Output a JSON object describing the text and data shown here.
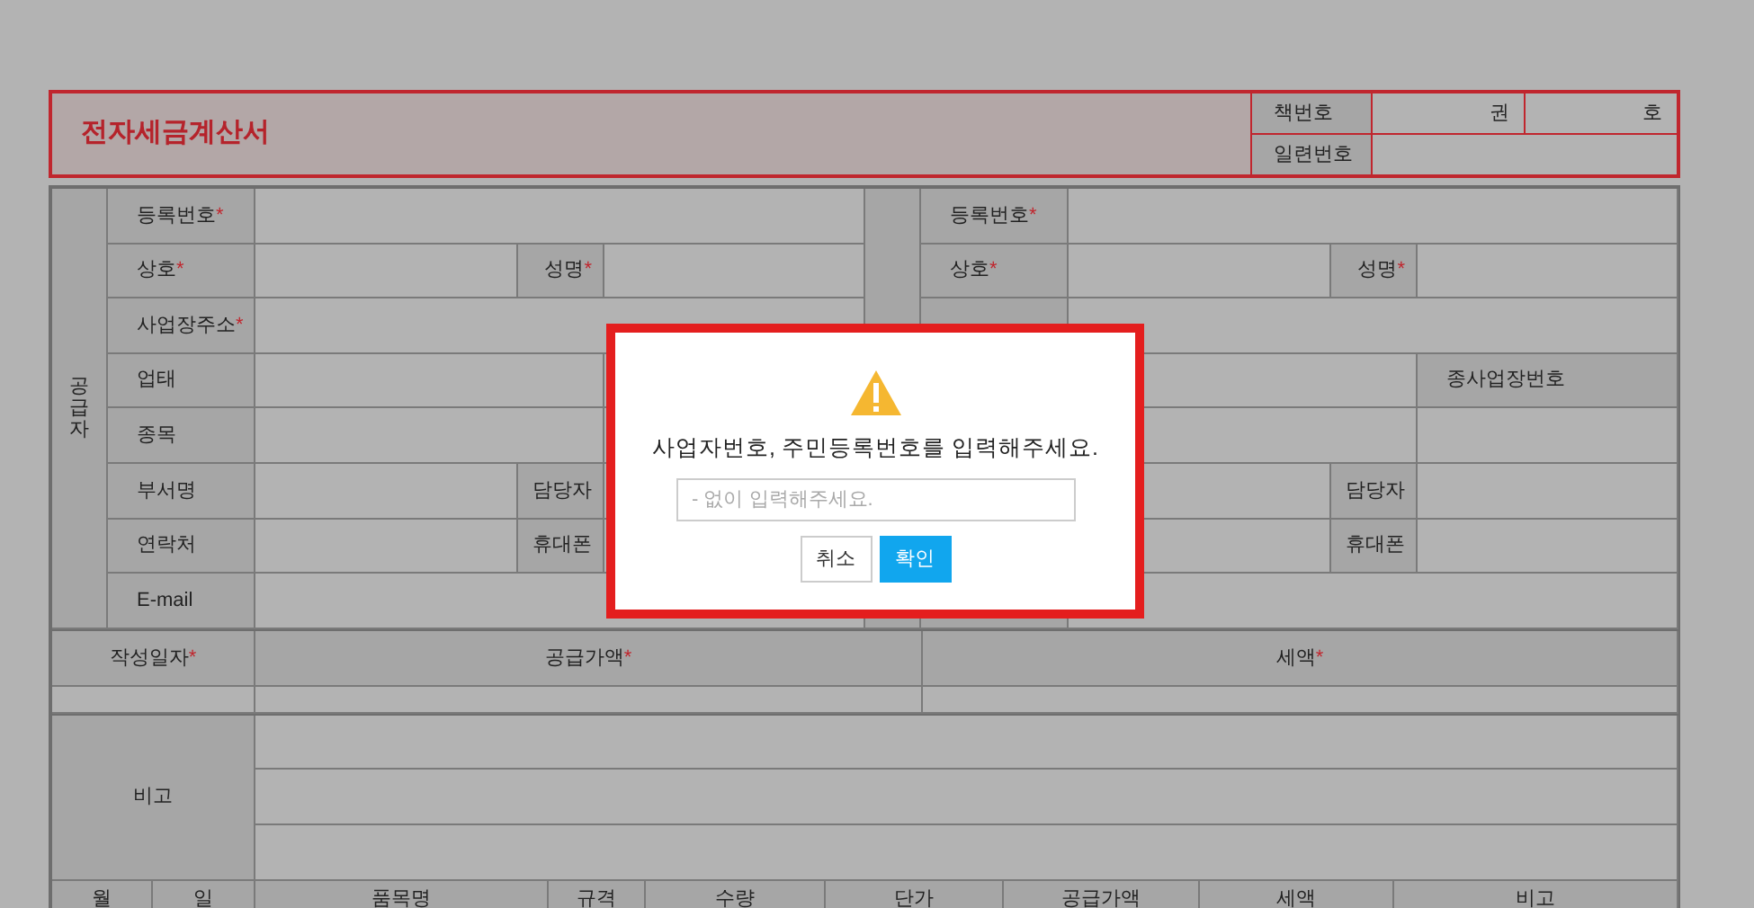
{
  "header": {
    "title": "전자세금계산서",
    "book_number_label": "책번호",
    "volume_unit": "권",
    "issue_unit": "호",
    "serial_number_label": "일련번호"
  },
  "supplier": {
    "section_label": "공급자",
    "rows": [
      {
        "kind": "single",
        "label": {
          "text": "등록번호",
          "mark": "*"
        }
      },
      {
        "kind": "pair",
        "label": {
          "text": "상호",
          "mark": "*"
        },
        "label2": {
          "text": "성명",
          "mark": "*"
        }
      },
      {
        "kind": "single",
        "label": {
          "text": "사업장주소",
          "mark": "*"
        }
      },
      {
        "kind": "split",
        "label": {
          "text": "업태"
        }
      },
      {
        "kind": "split",
        "label": {
          "text": "종목"
        }
      },
      {
        "kind": "pair",
        "label": {
          "text": "부서명"
        },
        "label2": {
          "text": "담당자"
        }
      },
      {
        "kind": "pair",
        "label": {
          "text": "연락처"
        },
        "label2": {
          "text": "휴대폰"
        }
      },
      {
        "kind": "single",
        "label": {
          "text": "E-mail"
        }
      }
    ]
  },
  "receiver": {
    "rows": [
      {
        "kind": "single",
        "label": {
          "text": "등록번호",
          "mark": "*"
        }
      },
      {
        "kind": "pair",
        "label": {
          "text": "상호",
          "mark": "*"
        },
        "label2": {
          "text": "성명",
          "mark": "*"
        }
      },
      {
        "kind": "single"
      },
      {
        "kind": "tail",
        "label2": {
          "text": "종사업장번호"
        }
      },
      {
        "kind": "split"
      },
      {
        "kind": "pair",
        "label2": {
          "text": "담당자"
        }
      },
      {
        "kind": "pair",
        "label2": {
          "text": "휴대폰"
        }
      },
      {
        "kind": "single"
      }
    ]
  },
  "totals": {
    "columns": [
      {
        "text": "작성일자",
        "mark": "*"
      },
      {
        "text": "공급가액",
        "mark": "*"
      },
      {
        "text": "세액",
        "mark": "*"
      }
    ]
  },
  "remarks": {
    "label": "비고"
  },
  "items": {
    "columns": [
      {
        "text": "월"
      },
      {
        "text": "일"
      },
      {
        "text": "품목명"
      },
      {
        "text": "규격"
      },
      {
        "text": "수량"
      },
      {
        "text": "단가"
      },
      {
        "text": "공급가액"
      },
      {
        "text": "세액"
      },
      {
        "text": "비고"
      }
    ]
  },
  "dialog": {
    "message": "사업자번호, 주민등록번호를 입력해주세요.",
    "input": {
      "placeholder": "- 없이 입력해주세요."
    },
    "buttons": [
      {
        "label": "취소",
        "kind": "secondary"
      },
      {
        "label": "확인",
        "kind": "primary"
      }
    ]
  }
}
